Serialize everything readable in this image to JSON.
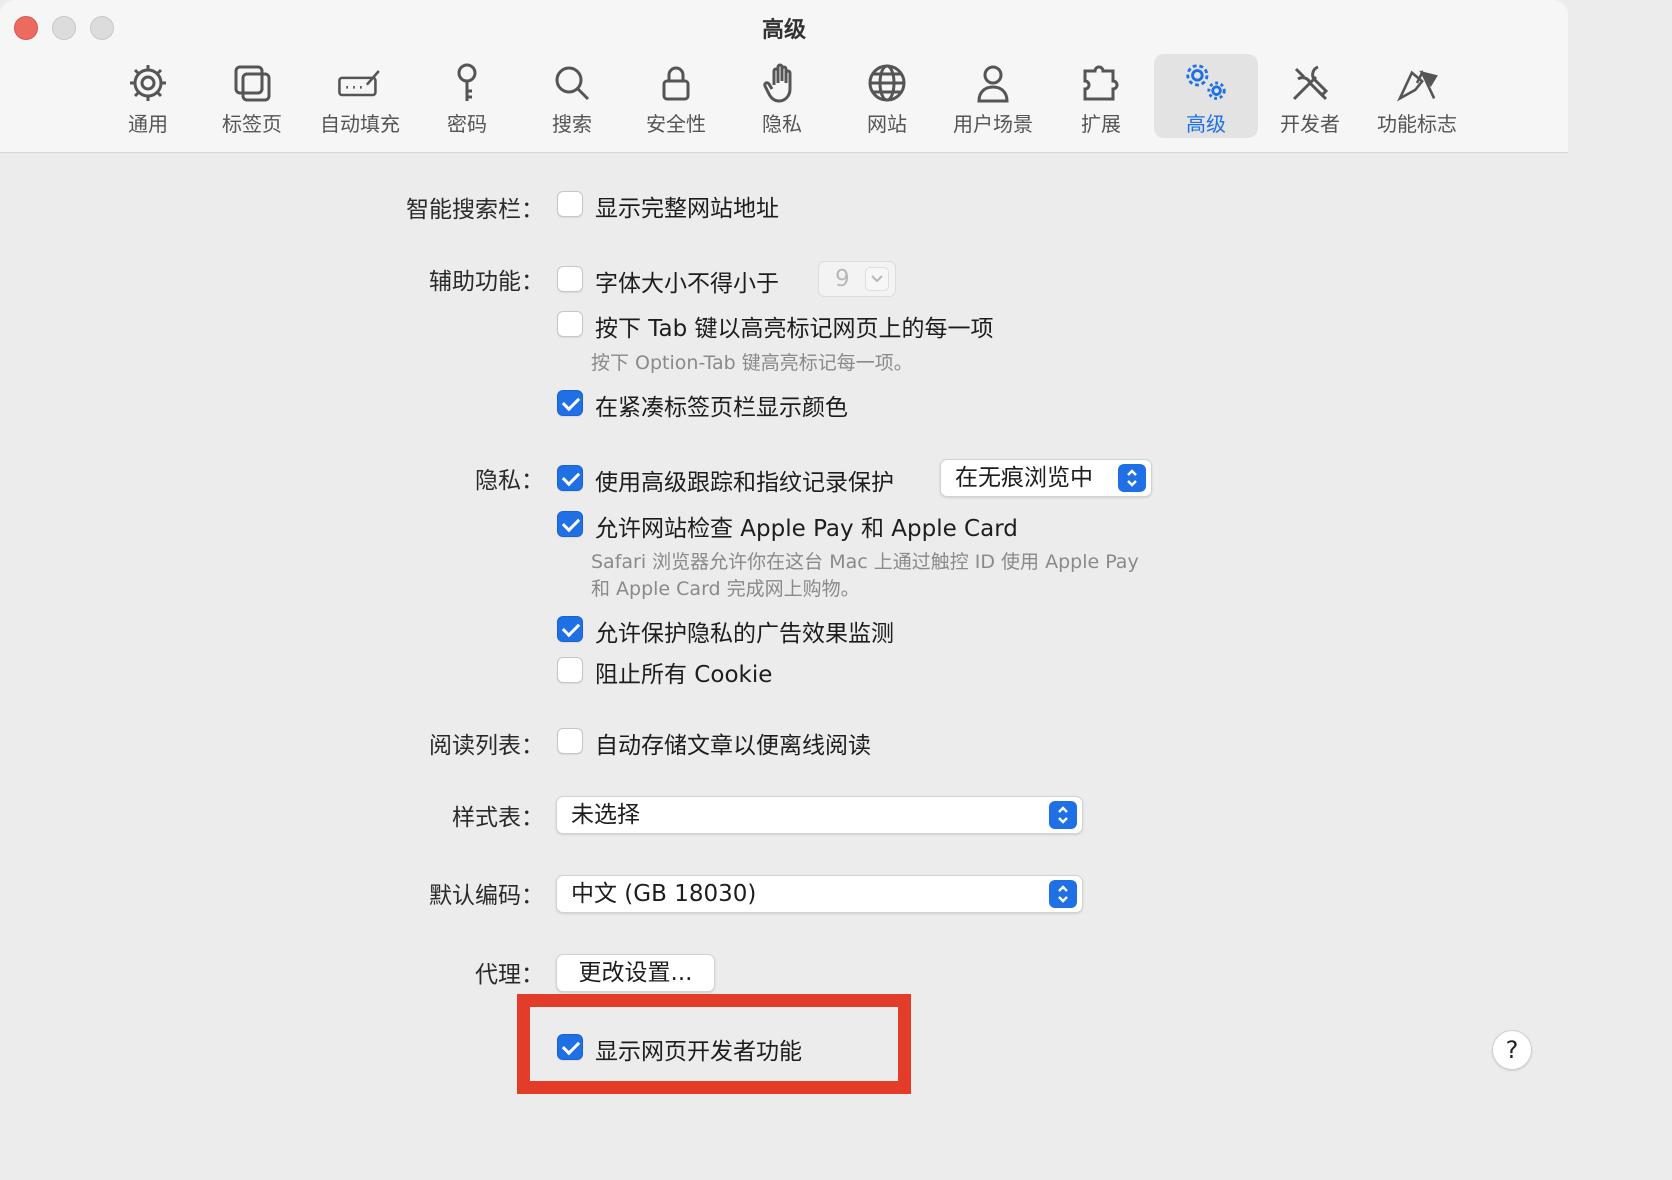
{
  "window": {
    "title": "高级"
  },
  "toolbar": {
    "tabs": [
      {
        "label": "通用",
        "icon": "gear-icon"
      },
      {
        "label": "标签页",
        "icon": "tabs-icon"
      },
      {
        "label": "自动填充",
        "icon": "autofill-icon"
      },
      {
        "label": "密码",
        "icon": "key-icon"
      },
      {
        "label": "搜索",
        "icon": "search-icon"
      },
      {
        "label": "安全性",
        "icon": "lock-icon"
      },
      {
        "label": "隐私",
        "icon": "hand-icon"
      },
      {
        "label": "网站",
        "icon": "globe-icon"
      },
      {
        "label": "用户场景",
        "icon": "person-icon"
      },
      {
        "label": "扩展",
        "icon": "puzzle-icon"
      },
      {
        "label": "高级",
        "icon": "advanced-gears-icon",
        "selected": true
      },
      {
        "label": "开发者",
        "icon": "tools-icon"
      },
      {
        "label": "功能标志",
        "icon": "flags-icon"
      }
    ]
  },
  "smart_search": {
    "label": "智能搜索栏：",
    "show_full_address": {
      "label": "显示完整网站地址",
      "checked": false
    }
  },
  "accessibility": {
    "label": "辅助功能：",
    "min_font": {
      "label": "字体大小不得小于",
      "checked": false,
      "value": "9"
    },
    "tab_highlight": {
      "label": "按下 Tab 键以高亮标记网页上的每一项",
      "checked": false,
      "note": "按下 Option-Tab 键高亮标记每一项。"
    },
    "compact_tab_color": {
      "label": "在紧凑标签页栏显示颜色",
      "checked": true
    }
  },
  "privacy": {
    "label": "隐私：",
    "tracking_protection": {
      "label": "使用高级跟踪和指纹记录保护",
      "checked": true,
      "mode": "在无痕浏览中"
    },
    "apple_pay": {
      "label": "允许网站检查 Apple Pay 和 Apple Card",
      "checked": true,
      "note_line1": "Safari 浏览器允许你在这台 Mac 上通过触控 ID 使用 Apple Pay",
      "note_line2": "和 Apple Card 完成网上购物。"
    },
    "ad_measurement": {
      "label": "允许保护隐私的广告效果监测",
      "checked": true
    },
    "block_cookies": {
      "label": "阻止所有 Cookie",
      "checked": false
    }
  },
  "reading_list": {
    "label": "阅读列表：",
    "save_offline": {
      "label": "自动存储文章以便离线阅读",
      "checked": false
    }
  },
  "stylesheet": {
    "label": "样式表：",
    "value": "未选择"
  },
  "encoding": {
    "label": "默认编码：",
    "value": "中文 (GB 18030)"
  },
  "proxy": {
    "label": "代理：",
    "button": "更改设置..."
  },
  "developer": {
    "show_web_developer": {
      "label": "显示网页开发者功能",
      "checked": true
    }
  },
  "help": {
    "label": "?"
  },
  "colors": {
    "accent": "#1f6fe5",
    "highlight_box": "#e33d2a"
  }
}
